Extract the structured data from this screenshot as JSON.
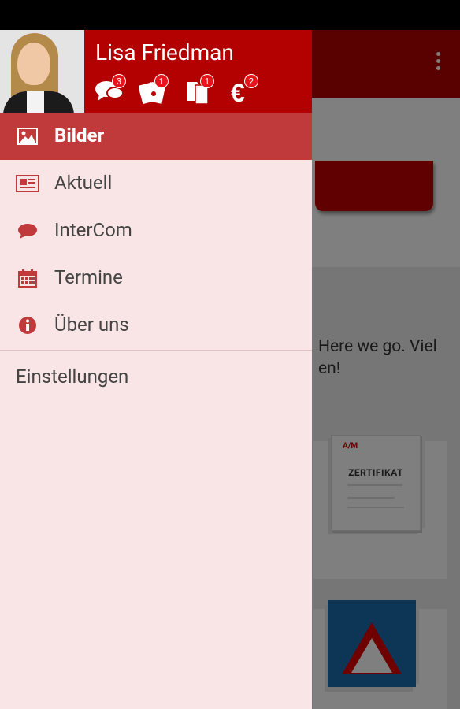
{
  "profile": {
    "name": "Lisa Friedman",
    "stats": [
      {
        "icon": "chat-bubbles-icon",
        "count": "3"
      },
      {
        "icon": "tickets-icon",
        "count": "1"
      },
      {
        "icon": "documents-icon",
        "count": "1"
      },
      {
        "icon": "euro-icon",
        "count": "2"
      }
    ]
  },
  "menu": {
    "items": [
      {
        "label": "Bilder",
        "icon": "image-icon",
        "active": true
      },
      {
        "label": "Aktuell",
        "icon": "newspaper-icon"
      },
      {
        "label": "InterCom",
        "icon": "speech-bubble-icon"
      },
      {
        "label": "Termine",
        "icon": "calendar-icon"
      },
      {
        "label": "Über uns",
        "icon": "info-icon"
      }
    ],
    "settings_label": "Einstellungen"
  },
  "background": {
    "feed_text": "Here we go. Viel en!",
    "cert_brand": "A/M",
    "cert_title": "ZERTIFIKAT"
  },
  "colors": {
    "primary": "#b30000",
    "active_item": "#c0393b",
    "drawer_bg": "#f9e5e5",
    "badge": "#e8141b"
  }
}
